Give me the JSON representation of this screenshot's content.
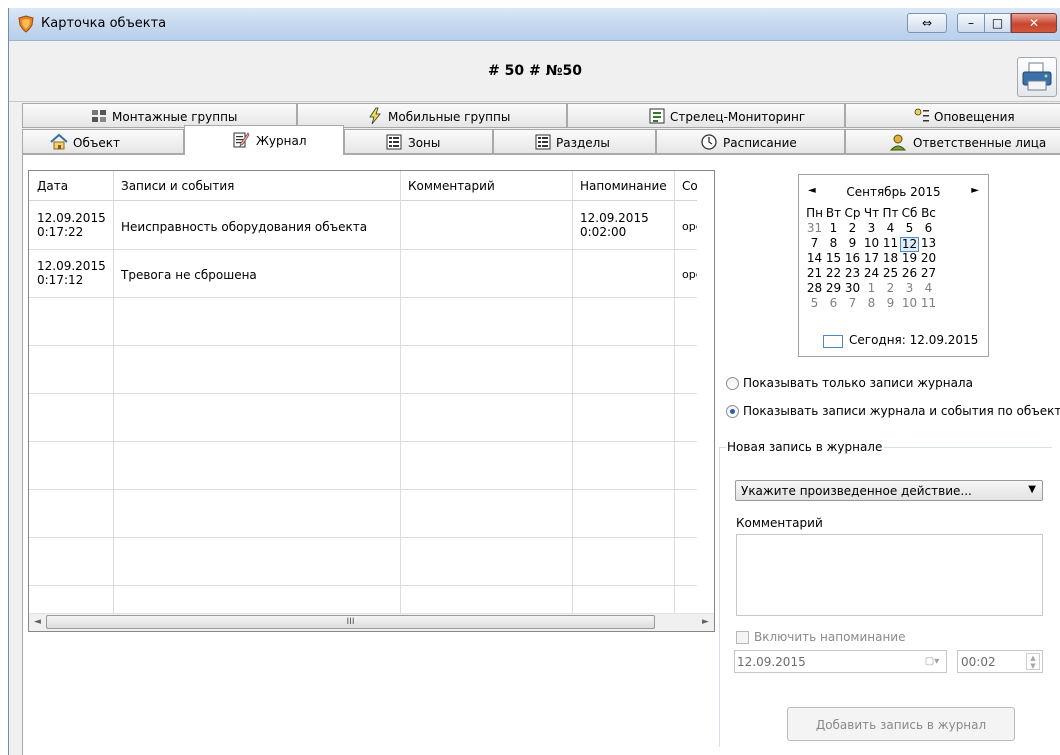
{
  "window": {
    "title": "Карточка объекта",
    "object_header": "# 50 # №50",
    "buttons": {
      "restore": "⇔",
      "minimize": "–",
      "maximize": "□",
      "close": "✕"
    }
  },
  "tabs_row1": [
    {
      "label": "Монтажные группы",
      "icon": "mounting-groups-icon"
    },
    {
      "label": "Мобильные группы",
      "icon": "lightning-icon"
    },
    {
      "label": "Стрелец-Мониторинг",
      "icon": "monitoring-icon"
    },
    {
      "label": "Оповещения",
      "icon": "notification-icon"
    }
  ],
  "tabs_row2": [
    {
      "label": "Объект",
      "icon": "house-icon"
    },
    {
      "label": "Журнал",
      "icon": "journal-icon",
      "active": true
    },
    {
      "label": "Зоны",
      "icon": "list-icon"
    },
    {
      "label": "Разделы",
      "icon": "list-icon"
    },
    {
      "label": "Расписание",
      "icon": "clock-icon"
    },
    {
      "label": "Ответственные лица",
      "icon": "person-icon"
    }
  ],
  "journal": {
    "columns": [
      "Дата",
      "Записи и события",
      "Комментарий",
      "Напоминание",
      "Сотрудник"
    ],
    "rows": [
      {
        "date1": "12.09.2015",
        "date2": "0:17:22",
        "event": "Неисправность оборудования объекта",
        "comment": "",
        "reminder1": "12.09.2015",
        "reminder2": "0:02:00",
        "employee": "operator"
      },
      {
        "date1": "12.09.2015",
        "date2": "0:17:12",
        "event": "Тревога не сброшена",
        "comment": "",
        "reminder1": "",
        "reminder2": "",
        "employee": "operator"
      }
    ],
    "scroll_grip": "III"
  },
  "calendar": {
    "month_label": "Сентябрь 2015",
    "prev": "◄",
    "next": "►",
    "weekdays": [
      "Пн",
      "Вт",
      "Ср",
      "Чт",
      "Пт",
      "Сб",
      "Вс"
    ],
    "weeks": [
      [
        "31",
        "1",
        "2",
        "3",
        "4",
        "5",
        "6"
      ],
      [
        "7",
        "8",
        "9",
        "10",
        "11",
        "12",
        "13"
      ],
      [
        "14",
        "15",
        "16",
        "17",
        "18",
        "19",
        "20"
      ],
      [
        "21",
        "22",
        "23",
        "24",
        "25",
        "26",
        "27"
      ],
      [
        "28",
        "29",
        "30",
        "1",
        "2",
        "3",
        "4"
      ],
      [
        "5",
        "6",
        "7",
        "8",
        "9",
        "10",
        "11"
      ]
    ],
    "selected_day": "12",
    "today_label": "Сегодня: 12.09.2015"
  },
  "filters": {
    "option1": "Показывать только записи журнала",
    "option2": "Показывать записи журнала и события по объекту",
    "selected": 2
  },
  "new_entry": {
    "group_title": "Новая запись в журнале",
    "action_placeholder": "Укажите произведенное действие...",
    "comment_label": "Комментарий",
    "reminder_label": "Включить напоминание",
    "reminder_date": "12.09.2015",
    "reminder_time": "00:02",
    "add_button": "Добавить запись в журнал"
  }
}
